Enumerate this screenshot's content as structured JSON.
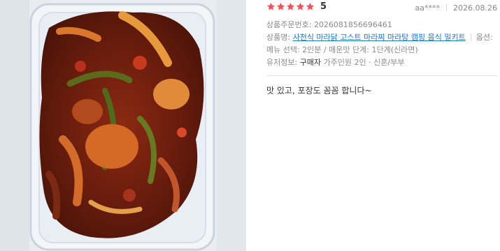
{
  "review": {
    "rating_value": "5",
    "stars_filled": 5,
    "stars_total": 5,
    "star_color": "#f2505a",
    "reviewer": "aa****",
    "date": "2026.08.26",
    "order_no_label": "상품주문번호:",
    "order_no": "2026081856696461",
    "product_label": "상품명:",
    "product_name": "사천식 마라닭 고스트 마라찌 마라탕 캠핑 음식 밀키트",
    "option_label": "옵션:",
    "menu_label": "메뉴 선택:",
    "menu_value": "2인분",
    "spice_label": "매운맛 단계:",
    "spice_value": "1단계(신라면)",
    "user_info_label": "유저정보:",
    "buyer_tag": "구매자",
    "household": "가주인원 2인 · 신혼/부부",
    "content": "맛 있고, 포장도 꼼꼼 합니다~"
  },
  "colors": {
    "link": "#1a73e8",
    "text": "#333333",
    "muted": "#8a8a8a"
  }
}
